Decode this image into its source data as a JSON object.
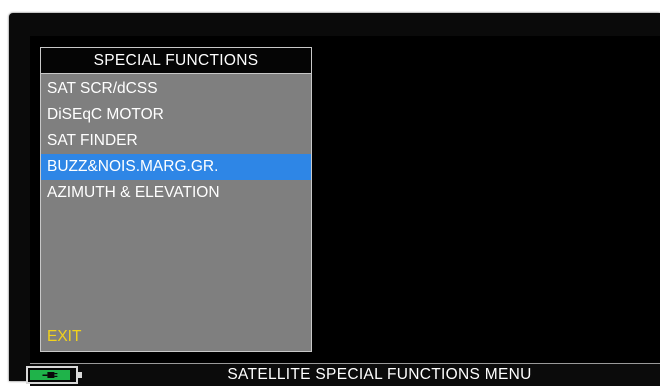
{
  "menu": {
    "title": "SPECIAL FUNCTIONS",
    "items": [
      {
        "label": "SAT SCR/dCSS",
        "selected": false
      },
      {
        "label": "DiSEqC MOTOR",
        "selected": false
      },
      {
        "label": "SAT FINDER",
        "selected": false
      },
      {
        "label": "BUZZ&NOIS.MARG.GR.",
        "selected": true
      },
      {
        "label": "AZIMUTH & ELEVATION",
        "selected": false
      }
    ],
    "exit_label": "EXIT"
  },
  "status_bar": {
    "title": "SATELLITE SPECIAL FUNCTIONS MENU",
    "battery_icon": "battery-charging-icon"
  },
  "colors": {
    "panel_bg": "#7f7f7f",
    "selected_bg": "#2e86e6",
    "exit_text": "#f2d21b",
    "screen_bg": "#000000",
    "battery_fill": "#1fb34a"
  }
}
